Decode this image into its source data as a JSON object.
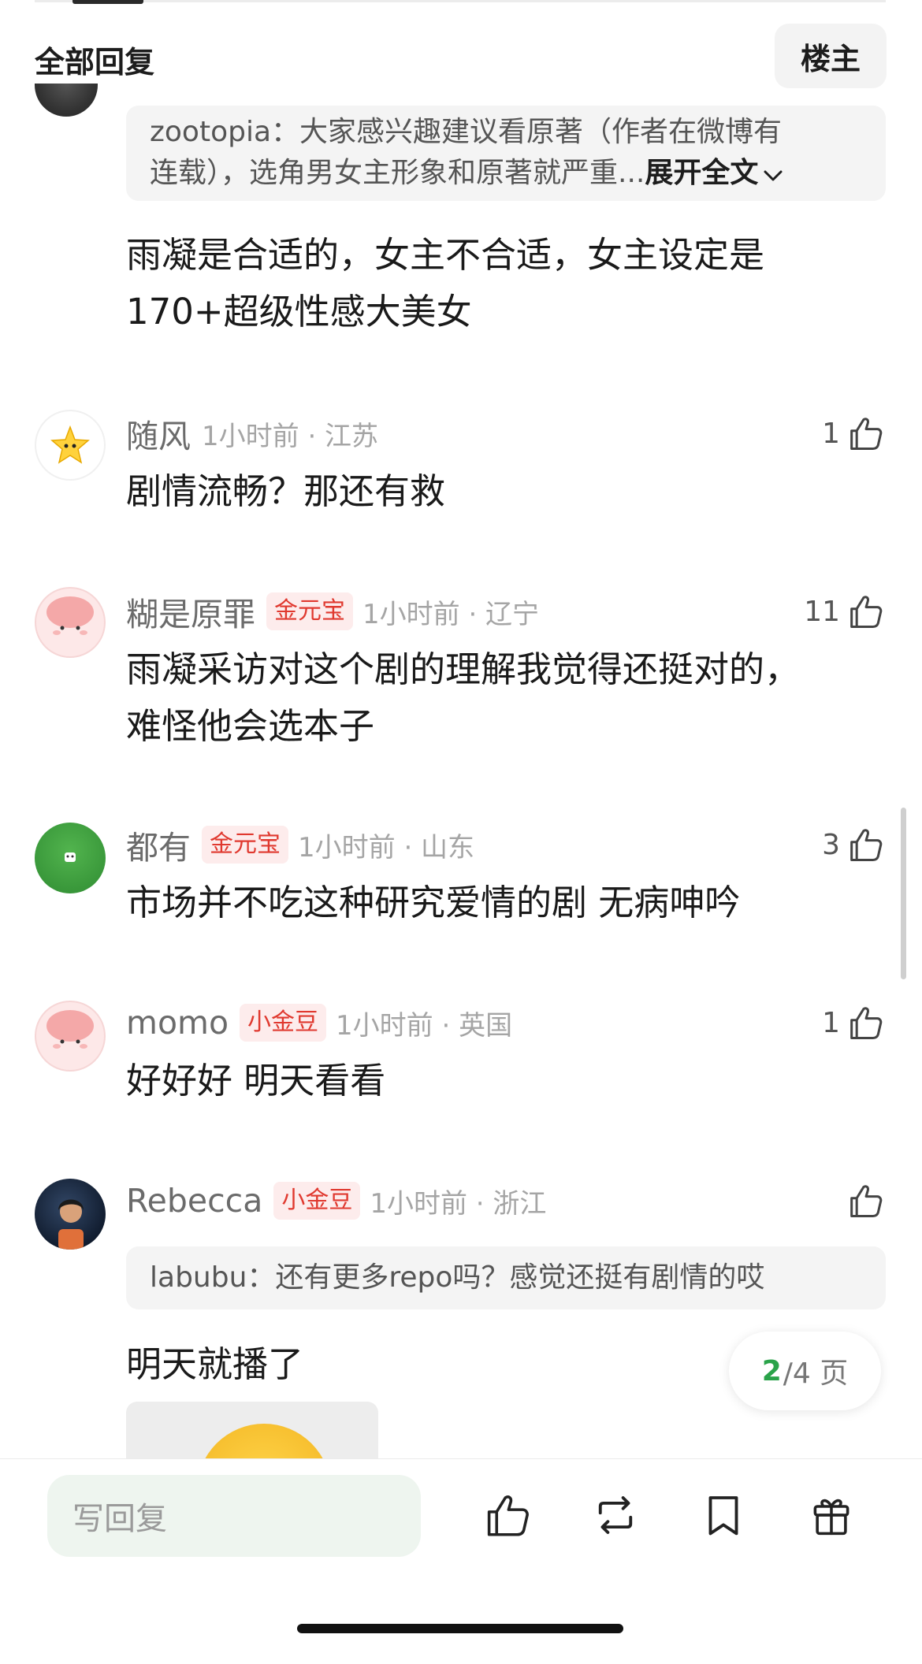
{
  "header": {
    "title": "全部回复",
    "host_label": "楼主"
  },
  "quote_top": {
    "user": "zootopia",
    "line1": "zootopia：大家感兴趣建议看原著（作者在微博有",
    "line2": "连载），选角男女主形象和原著就严重...",
    "expand": "展开全文"
  },
  "prev_comment": {
    "line1": "雨凝是合适的，女主不合适，女主设定是",
    "line2": "170+超级性感大美女"
  },
  "comments": [
    {
      "user": "随风",
      "badge": "",
      "time_loc": "1小时前 · 江苏",
      "likes": "1",
      "lines": [
        "剧情流畅？那还有救"
      ]
    },
    {
      "user": "糊是原罪",
      "badge": "金元宝",
      "time_loc": "1小时前 · 辽宁",
      "likes": "11",
      "lines": [
        "雨凝采访对这个剧的理解我觉得还挺对的，",
        "难怪他会选本子"
      ]
    },
    {
      "user": "都有",
      "badge": "金元宝",
      "time_loc": "1小时前 · 山东",
      "likes": "3",
      "lines": [
        "市场并不吃这种研究爱情的剧 无病呻吟"
      ]
    },
    {
      "user": "momo",
      "badge": "小金豆",
      "time_loc": "1小时前 · 英国",
      "likes": "1",
      "lines": [
        "好好好 明天看看"
      ]
    },
    {
      "user": "Rebecca",
      "badge": "小金豆",
      "time_loc": "1小时前 · 浙江",
      "likes": "",
      "quote": "labubu：还有更多repo吗？感觉还挺有剧情的哎",
      "lines": [
        "明天就播了"
      ]
    }
  ],
  "pagination": {
    "current": "2",
    "total_text": "/4 页"
  },
  "bottom_bar": {
    "reply_placeholder": "写回复"
  },
  "colors": {
    "accent_green": "#2aa34a",
    "badge_red": "#e0392f",
    "badge_bg": "#fdecec"
  },
  "icons": [
    "chevron-down-icon",
    "thumbs-up-icon",
    "repost-icon",
    "bookmark-icon",
    "gift-icon",
    "star-avatar-icon"
  ]
}
